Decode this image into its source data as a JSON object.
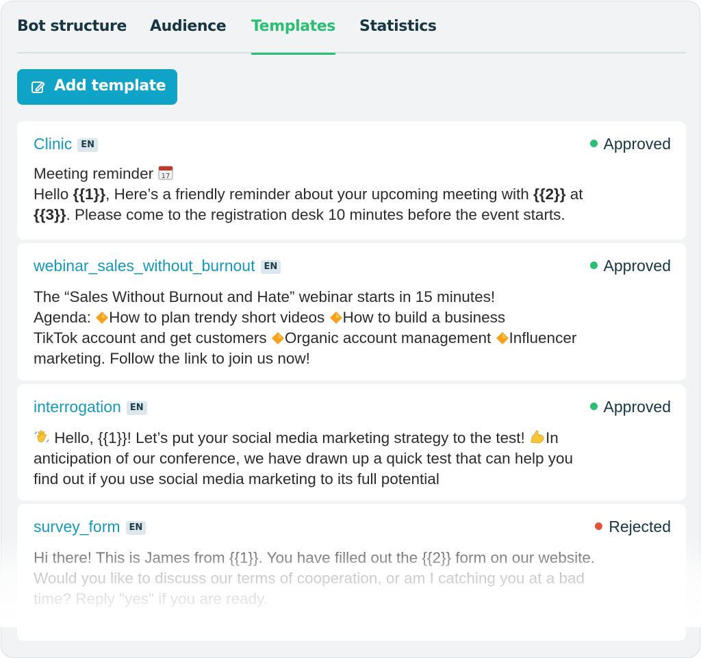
{
  "tabs": [
    {
      "label": "Bot structure",
      "active": false
    },
    {
      "label": "Audience",
      "active": false
    },
    {
      "label": "Templates",
      "active": true
    },
    {
      "label": "Statistics",
      "active": false
    }
  ],
  "add_button": {
    "label": "Add template",
    "icon": "edit-template-icon"
  },
  "colors": {
    "accent_green": "#2bbf73",
    "button_blue": "#0fa3c8",
    "link_blue": "#1599b9",
    "approved": "#2bbf73",
    "rejected": "#e5533d"
  },
  "templates": [
    {
      "name": "Clinic",
      "lang": "EN",
      "status": "Approved",
      "lines": [
        [
          "Meeting reminder "
        ],
        [
          "Hello ",
          "{{1}}",
          ", Here’s a friendly  reminder about your upcoming meeting with ",
          "{{2}}",
          " at"
        ],
        [
          "{{3}}",
          ". Please come to the registration desk 10 minutes before the event  starts."
        ]
      ]
    },
    {
      "name": "webinar_sales_without_burnout",
      "lang": "EN",
      "status": "Approved",
      "lines": [
        [
          "The “Sales Without Burnout and Hate” webinar starts in 15 minutes!"
        ],
        [
          "Agenda: ",
          "How to plan trendy short videos ",
          "How to build a business"
        ],
        [
          "TikTok account and get customers ",
          "Organic account management ",
          "Influencer"
        ],
        [
          "marketing. Follow the link to join us now!"
        ]
      ]
    },
    {
      "name": "interrogation",
      "lang": "EN",
      "status": "Approved",
      "lines": [
        [
          " Hello, {{1}}! Let’s put your social media marketing strategy to the test! ",
          "In"
        ],
        [
          "anticipation of our conference, we have drawn up a quick test that can help you"
        ],
        [
          "find out if you use social media marketing to its full potential"
        ]
      ]
    },
    {
      "name": "survey_form",
      "lang": "EN",
      "status": "Rejected",
      "lines": [
        [
          "Hi there! This is James from {{1}}. You have filled out the {{2}} form on our website."
        ],
        [
          "Would you like to discuss our terms of cooperation, or am I catching you at a bad"
        ],
        [
          "time? Reply \"yes\" if you are ready."
        ]
      ]
    }
  ]
}
